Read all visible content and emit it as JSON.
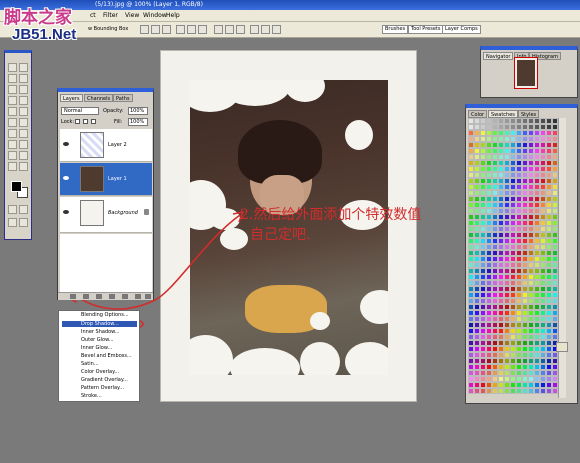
{
  "title_bar": {
    "document": "(5/13).jpg @ 100% (Layer 1, RGB/8)"
  },
  "menu": [
    "Filter",
    "View",
    "Window",
    "Help"
  ],
  "menu_prefix": "ct",
  "options_bar": {
    "show_bounding_box": "w Bounding Box"
  },
  "workspace_tabs": [
    "Brushes",
    "Tool Presets",
    "Layer Comps"
  ],
  "watermark": {
    "line1": "脚本之家",
    "line2": "JB51.Net"
  },
  "layers_panel": {
    "tabs": [
      "Layers",
      "Channels",
      "Paths"
    ],
    "blend_mode": "Normal",
    "opacity_label": "Opacity:",
    "opacity_value": "100%",
    "lock_label": "Lock:",
    "fill_label": "Fill:",
    "fill_value": "100%",
    "layers": [
      {
        "name": "Layer 2"
      },
      {
        "name": "Layer 1"
      },
      {
        "name": "Background"
      }
    ]
  },
  "effects_menu": {
    "items": [
      "Blending Options...",
      "Drop Shadow...",
      "Inner Shadow...",
      "Outer Glow...",
      "Inner Glow...",
      "Bevel and Emboss...",
      "Satin...",
      "Color Overlay...",
      "Gradient Overlay...",
      "Pattern Overlay...",
      "Stroke..."
    ],
    "selected": "Drop Shadow..."
  },
  "annotation": {
    "line1": "2.然后给外面添加个特效数值",
    "line2": "自己定吧."
  },
  "navigator_tabs": [
    "Navigator",
    "Info",
    "Histogram"
  ],
  "swatches_tabs": [
    "Color",
    "Swatches",
    "Styles"
  ],
  "accent_colors": {
    "selection": "#316ac5",
    "annotation_red": "#d22c2c"
  }
}
